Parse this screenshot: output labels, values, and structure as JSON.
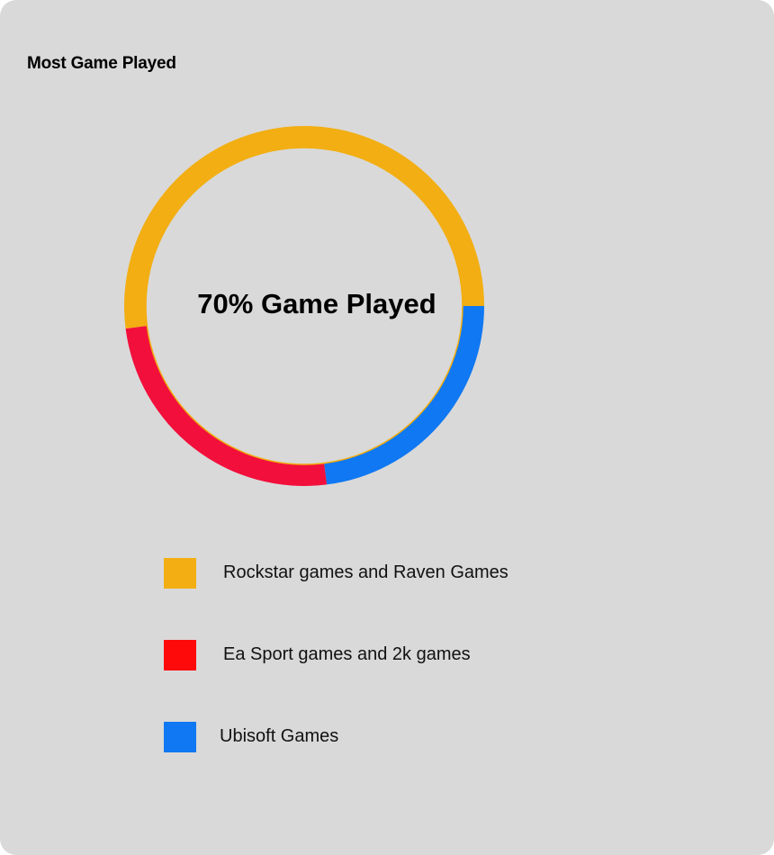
{
  "card": {
    "title": "Most Game Played",
    "background": "#d9d9d9"
  },
  "chart_data": {
    "type": "pie",
    "style": "donut",
    "title": "Most Game Played",
    "center_text": "70% Game Played",
    "segments": [
      {
        "name": "Rockstar games and Raven Games",
        "value": 52,
        "color": "#f2ae12"
      },
      {
        "name": "Ea Sport games and 2k games",
        "value": 25,
        "color": "#f20f3c"
      },
      {
        "name": "Ubisoft Games",
        "value": 23,
        "color": "#0f78f2"
      }
    ],
    "legend": {
      "placement": "bottom",
      "items": [
        {
          "label": "Rockstar games and Raven Games",
          "color": "#f2ae12"
        },
        {
          "label": "Ea Sport games and 2k games",
          "color": "#ff0a0a"
        },
        {
          "label": "Ubisoft Games",
          "color": "#0f78f2"
        }
      ]
    }
  }
}
